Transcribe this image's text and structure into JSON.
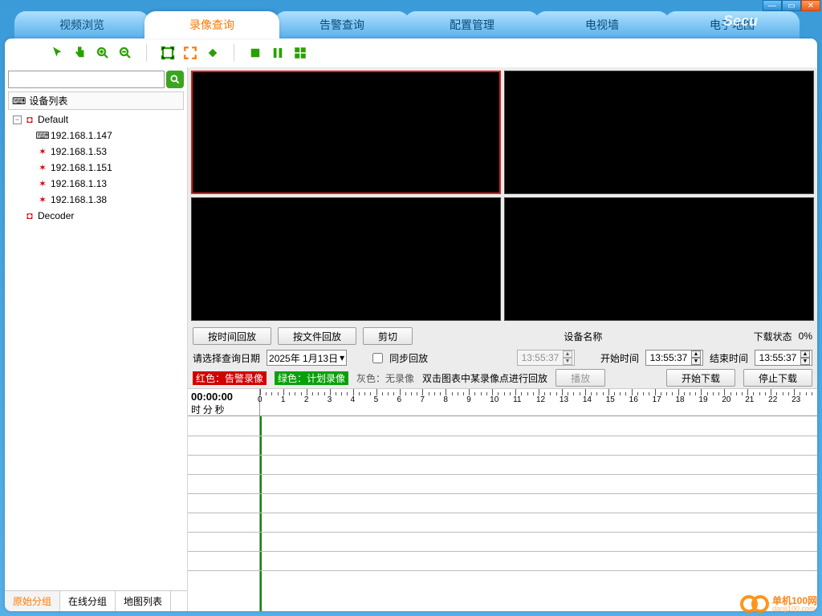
{
  "tabs": [
    "视频浏览",
    "录像查询",
    "告警查询",
    "配置管理",
    "电视墙",
    "电子地图"
  ],
  "active_tab": 1,
  "brand": "Secu",
  "search": {
    "placeholder": ""
  },
  "device_list_header": "设备列表",
  "tree": {
    "root_label": "Default",
    "nodes": [
      "192.168.1.147",
      "192.168.1.53",
      "192.168.1.151",
      "192.168.1.13",
      "192.168.1.38"
    ],
    "decoder_label": "Decoder"
  },
  "bottom_tabs": [
    "原始分组",
    "在线分组",
    "地图列表"
  ],
  "active_bottom_tab": 0,
  "buttons": {
    "by_time": "按时间回放",
    "by_file": "按文件回放",
    "cut": "剪切",
    "play": "播放",
    "start_dl": "开始下载",
    "stop_dl": "停止下载"
  },
  "labels": {
    "device_name": "设备名称",
    "download_status": "下载状态",
    "select_date": "请选择查询日期",
    "sync_playback": "同步回放",
    "start_time": "开始时间",
    "end_time": "结束时间",
    "red": "红色：告警录像",
    "green": "绿色：计划录像",
    "gray": "灰色：无录像",
    "hint": "双击图表中某录像点进行回放"
  },
  "values": {
    "download_pct": "0%",
    "date": "2025年 1月13日",
    "time1": "13:55:37",
    "start_time": "13:55:37",
    "end_time": "13:55:37",
    "timeline_big": "00:00:00",
    "timeline_sub_h": "时",
    "timeline_sub_m": "分",
    "timeline_sub_s": "秒"
  },
  "timeline_hours": [
    0,
    1,
    2,
    3,
    4,
    5,
    6,
    7,
    8,
    9,
    10,
    11,
    12,
    13,
    14,
    15,
    16,
    17,
    18,
    19,
    20,
    21,
    22,
    23
  ],
  "watermark": {
    "name": "单机100网",
    "url": "danji100.com"
  }
}
